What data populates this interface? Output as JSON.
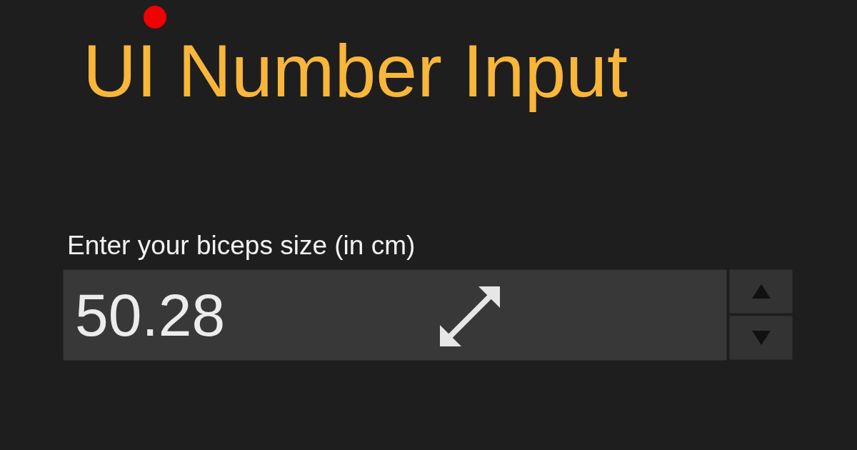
{
  "title": "UI Number Input",
  "field": {
    "label": "Enter your biceps size (in cm)",
    "value": "50.28"
  }
}
